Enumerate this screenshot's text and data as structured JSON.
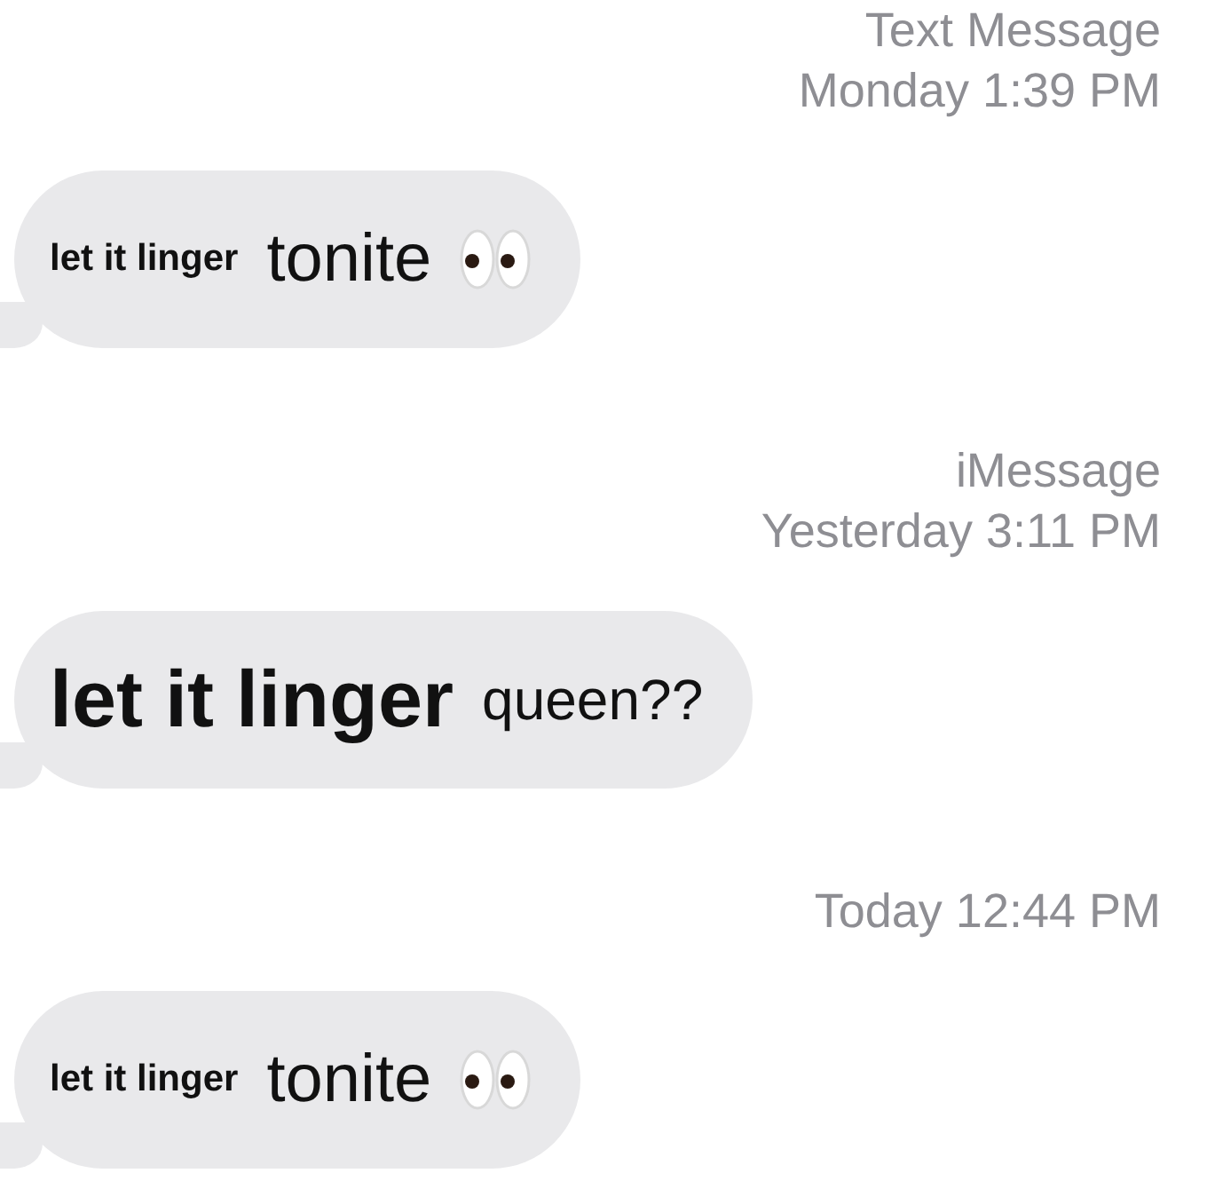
{
  "thread": [
    {
      "kind": "stamp",
      "lines": [
        "Text Message",
        "Monday 1:39 PM"
      ]
    },
    {
      "kind": "bubble",
      "lead": "let it linger",
      "text": "tonite",
      "eyes": true
    },
    {
      "kind": "stamp",
      "lines": [
        "iMessage",
        "Yesterday 3:11 PM"
      ]
    },
    {
      "kind": "shout",
      "lead": "let it linger",
      "text": "queen??",
      "eyes": false
    },
    {
      "kind": "stamp",
      "lines": [
        "Today 12:44 PM"
      ]
    },
    {
      "kind": "bubble",
      "lead": "let it linger",
      "text": "tonite",
      "eyes": true
    }
  ]
}
